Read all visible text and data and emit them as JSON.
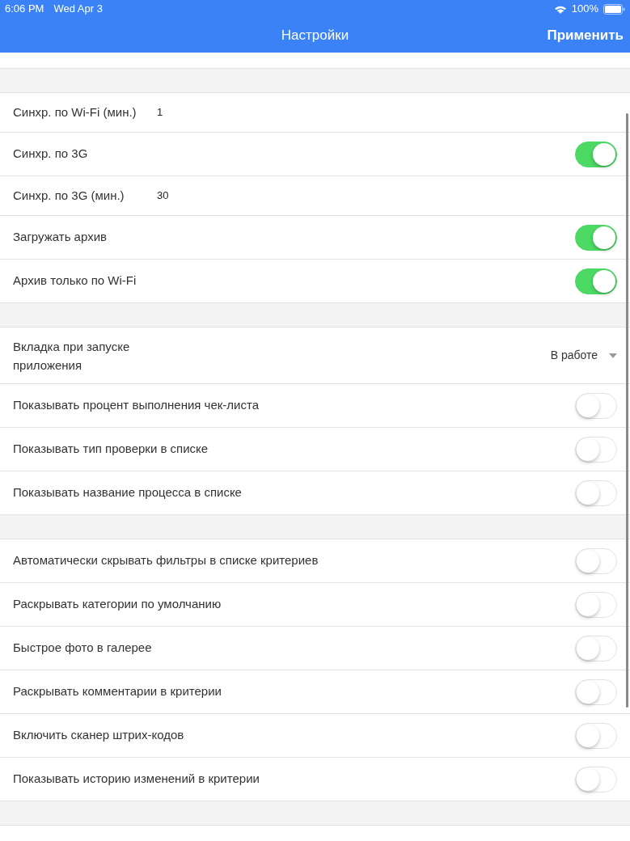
{
  "status_bar": {
    "time": "6:06 PM",
    "date": "Wed Apr 3",
    "battery": "100%"
  },
  "nav_bar": {
    "title": "Настройки",
    "action": "Применить"
  },
  "sections": [
    {
      "rows": [
        {
          "kind": "value",
          "label": "Синхр. по Wi-Fi (мин.)",
          "value": "1"
        },
        {
          "kind": "toggle",
          "label": "Синхр. по 3G",
          "on": true
        },
        {
          "kind": "value",
          "label": "Синхр. по 3G (мин.)",
          "value": "30"
        },
        {
          "kind": "toggle",
          "label": "Загружать архив",
          "on": true
        },
        {
          "kind": "toggle",
          "label": "Архив только по Wi-Fi",
          "on": true
        }
      ]
    },
    {
      "rows": [
        {
          "kind": "select",
          "label": "Вкладка при запуске приложения",
          "value": "В работе"
        },
        {
          "kind": "toggle",
          "label": "Показывать процент выполнения чек-листа",
          "on": false
        },
        {
          "kind": "toggle",
          "label": "Показывать тип проверки в списке",
          "on": false
        },
        {
          "kind": "toggle",
          "label": "Показывать название процесса в списке",
          "on": false
        }
      ]
    },
    {
      "rows": [
        {
          "kind": "toggle",
          "label": "Автоматически скрывать фильтры в списке критериев",
          "on": false
        },
        {
          "kind": "toggle",
          "label": "Раскрывать категории по умолчанию",
          "on": false
        },
        {
          "kind": "toggle",
          "label": "Быстрое фото в галерее",
          "on": false
        },
        {
          "kind": "toggle",
          "label": "Раскрывать комментарии в критерии",
          "on": false
        },
        {
          "kind": "toggle",
          "label": "Включить сканер штрих-кодов",
          "on": false
        },
        {
          "kind": "toggle",
          "label": "Показывать историю изменений в критерии",
          "on": false
        }
      ]
    }
  ]
}
